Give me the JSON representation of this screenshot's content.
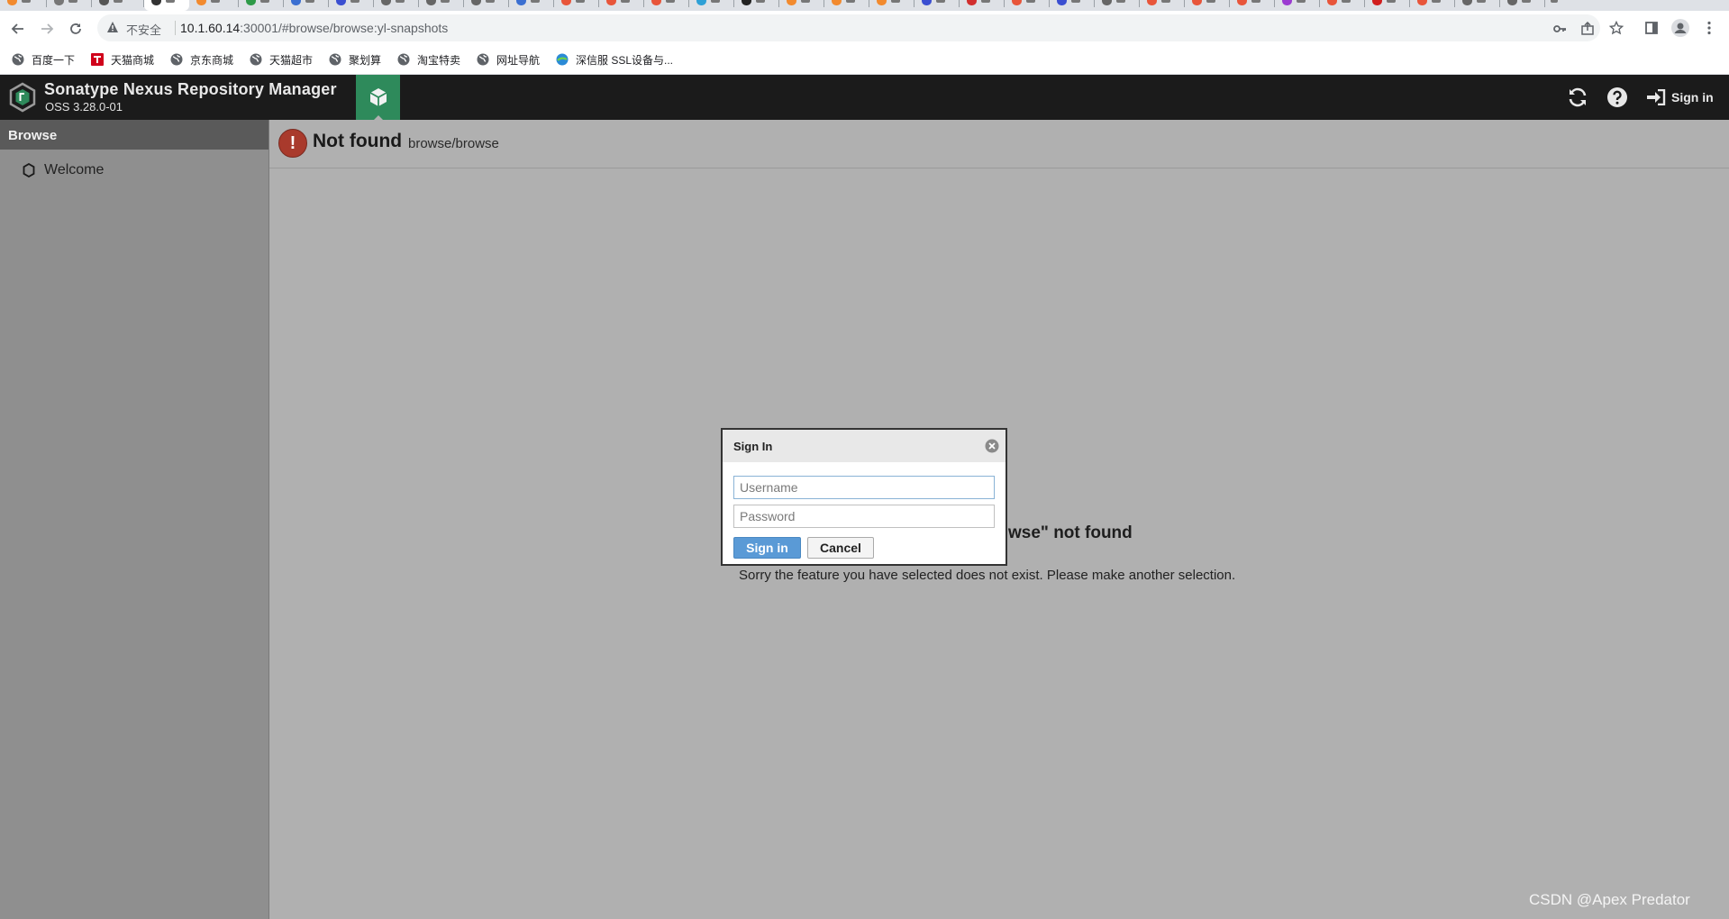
{
  "browser": {
    "url_host": "10.1.60.14",
    "url_path": ":30001/#browse/browse:yl-snapshots",
    "security_label": "不安全",
    "bookmarks": [
      {
        "label": "百度一下",
        "icon": "globe-icon"
      },
      {
        "label": "天猫商城",
        "icon": "tmall-icon"
      },
      {
        "label": "京东商城",
        "icon": "globe-icon"
      },
      {
        "label": "天猫超市",
        "icon": "globe-icon"
      },
      {
        "label": "聚划算",
        "icon": "globe-icon"
      },
      {
        "label": "淘宝特卖",
        "icon": "globe-icon"
      },
      {
        "label": "网址导航",
        "icon": "globe-icon"
      },
      {
        "label": "深信服 SSL设备与...",
        "icon": "sangfor-icon"
      }
    ]
  },
  "app": {
    "title": "Sonatype Nexus Repository Manager",
    "version": "OSS 3.28.0-01",
    "signin_label": "Sign in",
    "accent_color": "#2e8a5b"
  },
  "sidebar": {
    "heading": "Browse",
    "items": [
      {
        "label": "Welcome"
      }
    ]
  },
  "page": {
    "title": "Not found",
    "subtitle": "browse/browse",
    "not_found_title_visible": "wse\" not found",
    "not_found_message": "Sorry the feature you have selected does not exist. Please make another selection."
  },
  "dialog": {
    "title": "Sign In",
    "username_placeholder": "Username",
    "password_placeholder": "Password",
    "signin_button": "Sign in",
    "cancel_button": "Cancel"
  },
  "watermark": "CSDN @Apex   Predator"
}
